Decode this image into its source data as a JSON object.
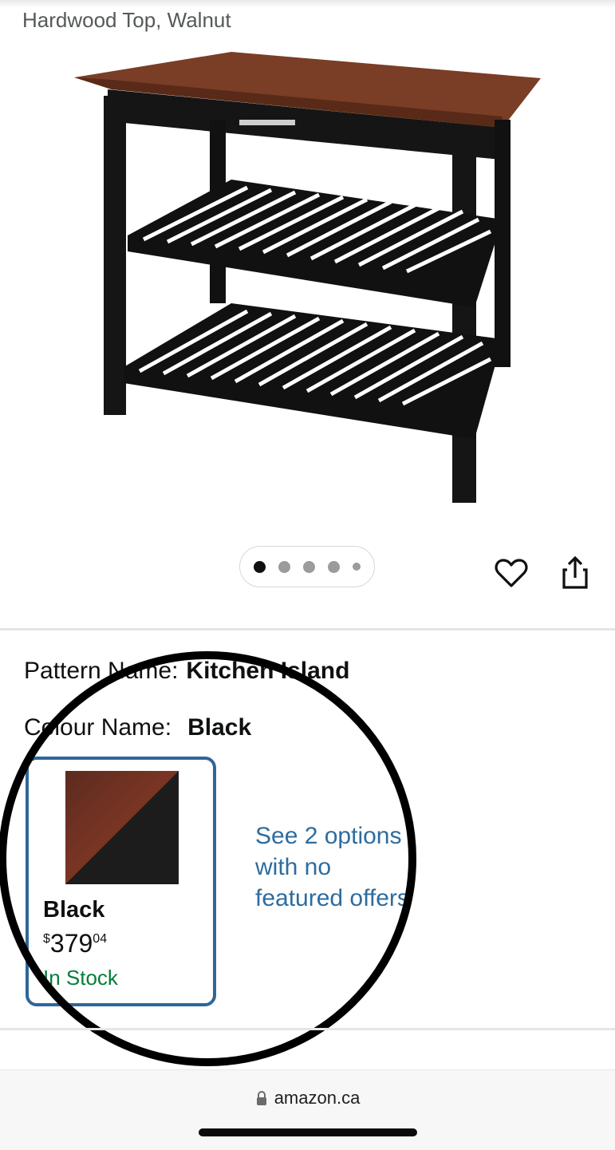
{
  "product": {
    "subtitle": "Hardwood Top, Walnut",
    "image_name": "kitchen-island-image",
    "carousel": {
      "count": 5,
      "active_index": 0
    }
  },
  "actions": {
    "wishlist_icon": "heart-icon",
    "share_icon": "share-icon"
  },
  "variations": {
    "pattern_label": "Pattern Name:",
    "pattern_value": "Kitchen Island",
    "colour_label": "Colour Name:",
    "colour_value": "Black"
  },
  "swatch": {
    "name": "Black",
    "price_symbol": "$",
    "price_whole": "379",
    "price_fraction": "04",
    "stock": "In Stock"
  },
  "options_link": "See 2 options with no featured offers",
  "browser": {
    "url": "amazon.ca"
  },
  "colors": {
    "accent_blue": "#2e6699",
    "link_blue": "#2e6c9e",
    "in_stock_green": "#067d3b"
  }
}
